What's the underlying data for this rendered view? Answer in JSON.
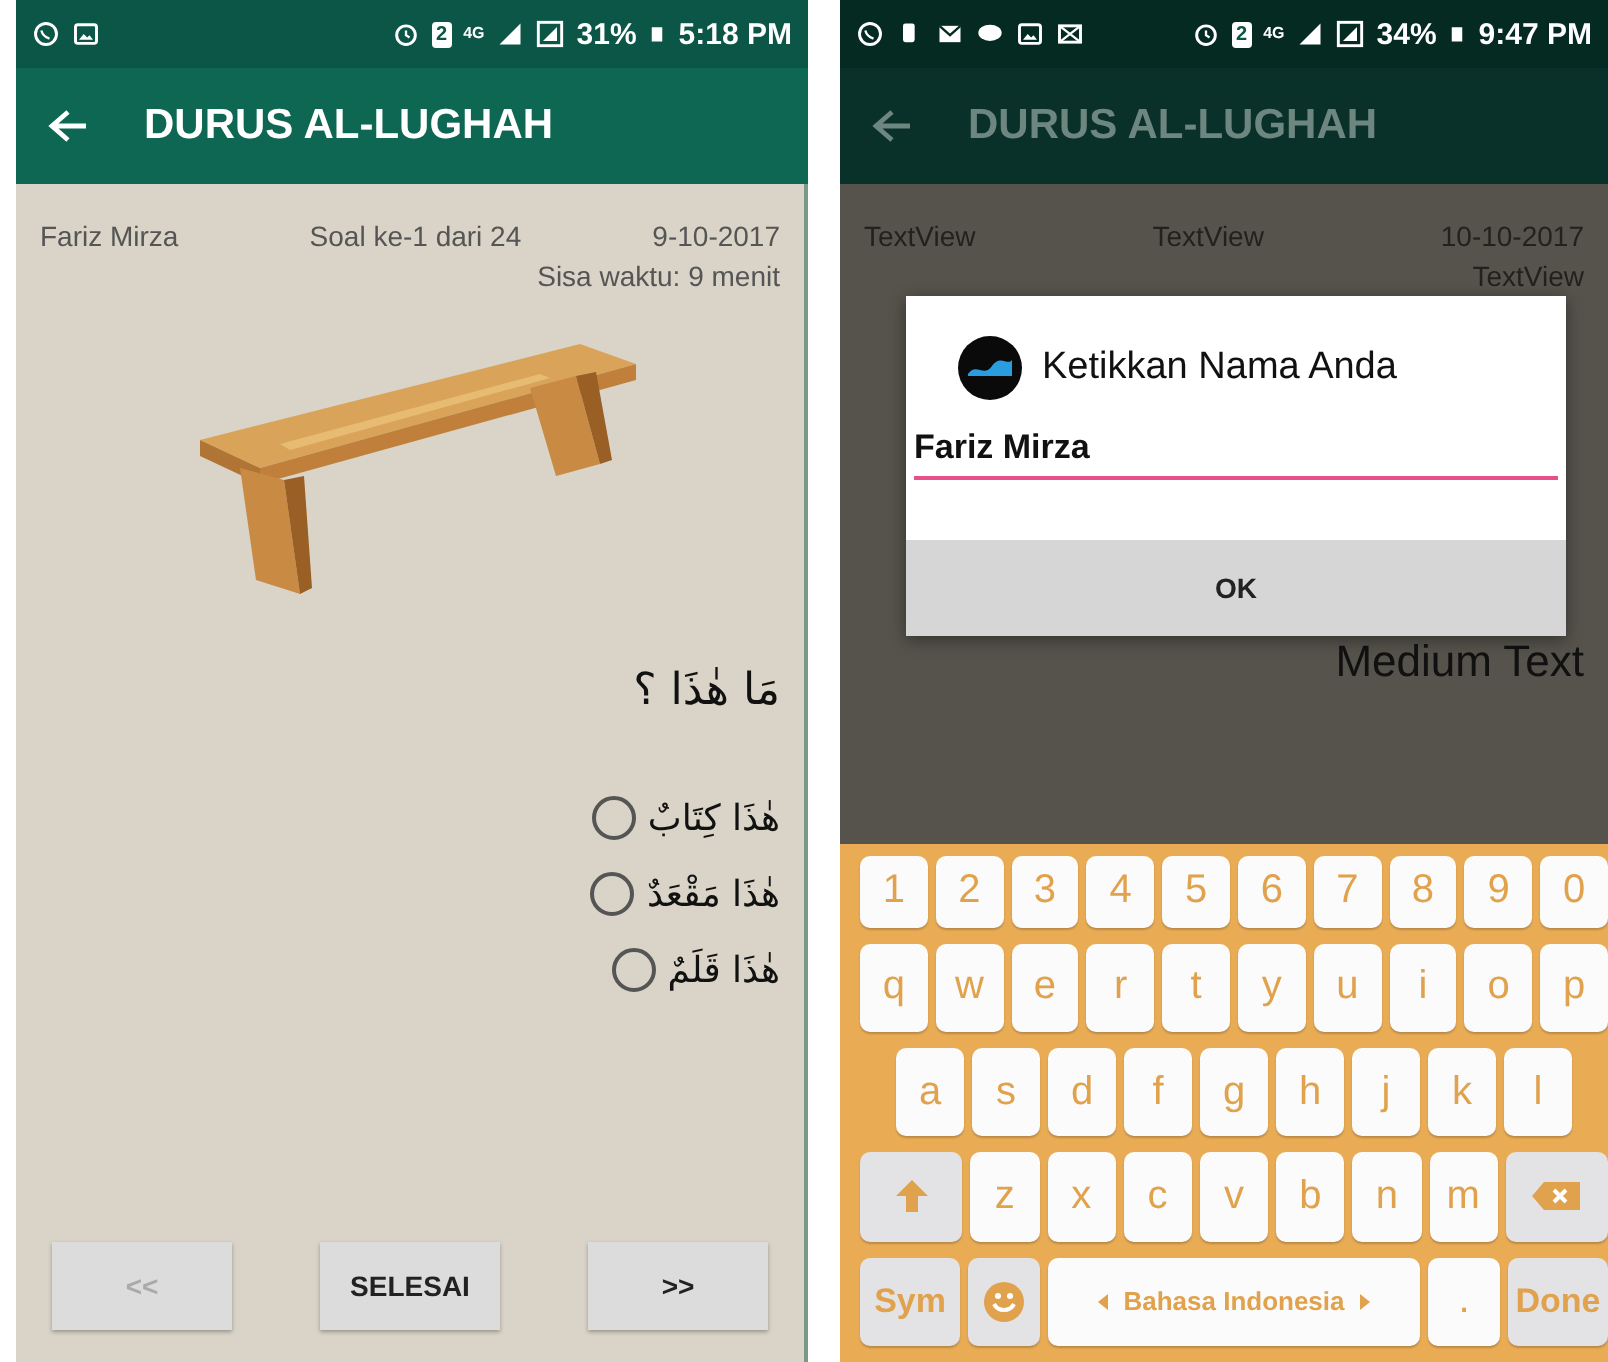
{
  "left_screen": {
    "status_bar": {
      "sim_slot": "2",
      "network": "4G",
      "battery": "31%",
      "time": "5:18 PM"
    },
    "app_bar": {
      "title": "DURUS AL-LUGHAH"
    },
    "header": {
      "name": "Fariz Mirza",
      "question_number": "Soal ke-1 dari 24",
      "date": "9-10-2017",
      "time_left": "Sisa waktu: 9 menit"
    },
    "question": "مَا هٰذَا ؟",
    "options": [
      {
        "label": "هٰذَا كِتَابٌ",
        "selected": false
      },
      {
        "label": "هٰذَا مَقْعَدٌ",
        "selected": false
      },
      {
        "label": "هٰذَا قَلَمٌ",
        "selected": false
      }
    ],
    "buttons": [
      {
        "label": "<<",
        "disabled": true
      },
      {
        "label": "SELESAI",
        "disabled": false
      },
      {
        "label": ">>",
        "disabled": false
      }
    ]
  },
  "right_screen": {
    "status_bar": {
      "sim_slot": "2",
      "network": "4G",
      "battery": "34%",
      "time": "9:47 PM"
    },
    "app_bar": {
      "title": "DURUS AL-LUGHAH"
    },
    "header": {
      "column_1": "TextView",
      "column_2": "TextView",
      "date": "10-10-2017",
      "column_4": "TextView"
    },
    "medium_text": "Medium Text",
    "dialog": {
      "title": "Ketikkan Nama Anda",
      "input_value": "Fariz Mirza",
      "button": "OK"
    },
    "keyboard": {
      "rows": [
        {
          "keys": [
            {
              "kind": "char",
              "label": "1"
            },
            {
              "kind": "char",
              "label": "2"
            },
            {
              "kind": "char",
              "label": "3"
            },
            {
              "kind": "char",
              "label": "4"
            },
            {
              "kind": "char",
              "label": "5"
            },
            {
              "kind": "char",
              "label": "6"
            },
            {
              "kind": "char",
              "label": "7"
            },
            {
              "kind": "char",
              "label": "8"
            },
            {
              "kind": "char",
              "label": "9"
            },
            {
              "kind": "char",
              "label": "0"
            }
          ]
        },
        {
          "keys": [
            {
              "kind": "char",
              "label": "q"
            },
            {
              "kind": "char",
              "label": "w"
            },
            {
              "kind": "char",
              "label": "e"
            },
            {
              "kind": "char",
              "label": "r"
            },
            {
              "kind": "char",
              "label": "t"
            },
            {
              "kind": "char",
              "label": "y"
            },
            {
              "kind": "char",
              "label": "u"
            },
            {
              "kind": "char",
              "label": "i"
            },
            {
              "kind": "char",
              "label": "o"
            },
            {
              "kind": "char",
              "label": "p"
            }
          ]
        },
        {
          "keys": [
            {
              "kind": "char",
              "label": "a"
            },
            {
              "kind": "char",
              "label": "s"
            },
            {
              "kind": "char",
              "label": "d"
            },
            {
              "kind": "char",
              "label": "f"
            },
            {
              "kind": "char",
              "label": "g"
            },
            {
              "kind": "char",
              "label": "h"
            },
            {
              "kind": "char",
              "label": "j"
            },
            {
              "kind": "char",
              "label": "k"
            },
            {
              "kind": "char",
              "label": "l"
            }
          ]
        },
        {
          "keys": [
            {
              "kind": "shift"
            },
            {
              "kind": "char",
              "label": "z"
            },
            {
              "kind": "char",
              "label": "x"
            },
            {
              "kind": "char",
              "label": "c"
            },
            {
              "kind": "char",
              "label": "v"
            },
            {
              "kind": "char",
              "label": "b"
            },
            {
              "kind": "char",
              "label": "n"
            },
            {
              "kind": "char",
              "label": "m"
            },
            {
              "kind": "backspace"
            }
          ]
        },
        {
          "keys": [
            {
              "kind": "sym",
              "label": "Sym"
            },
            {
              "kind": "emoji"
            },
            {
              "kind": "space",
              "label": "Bahasa Indonesia"
            },
            {
              "kind": "char",
              "label": "."
            },
            {
              "kind": "done",
              "label": "Done"
            }
          ]
        }
      ]
    }
  }
}
